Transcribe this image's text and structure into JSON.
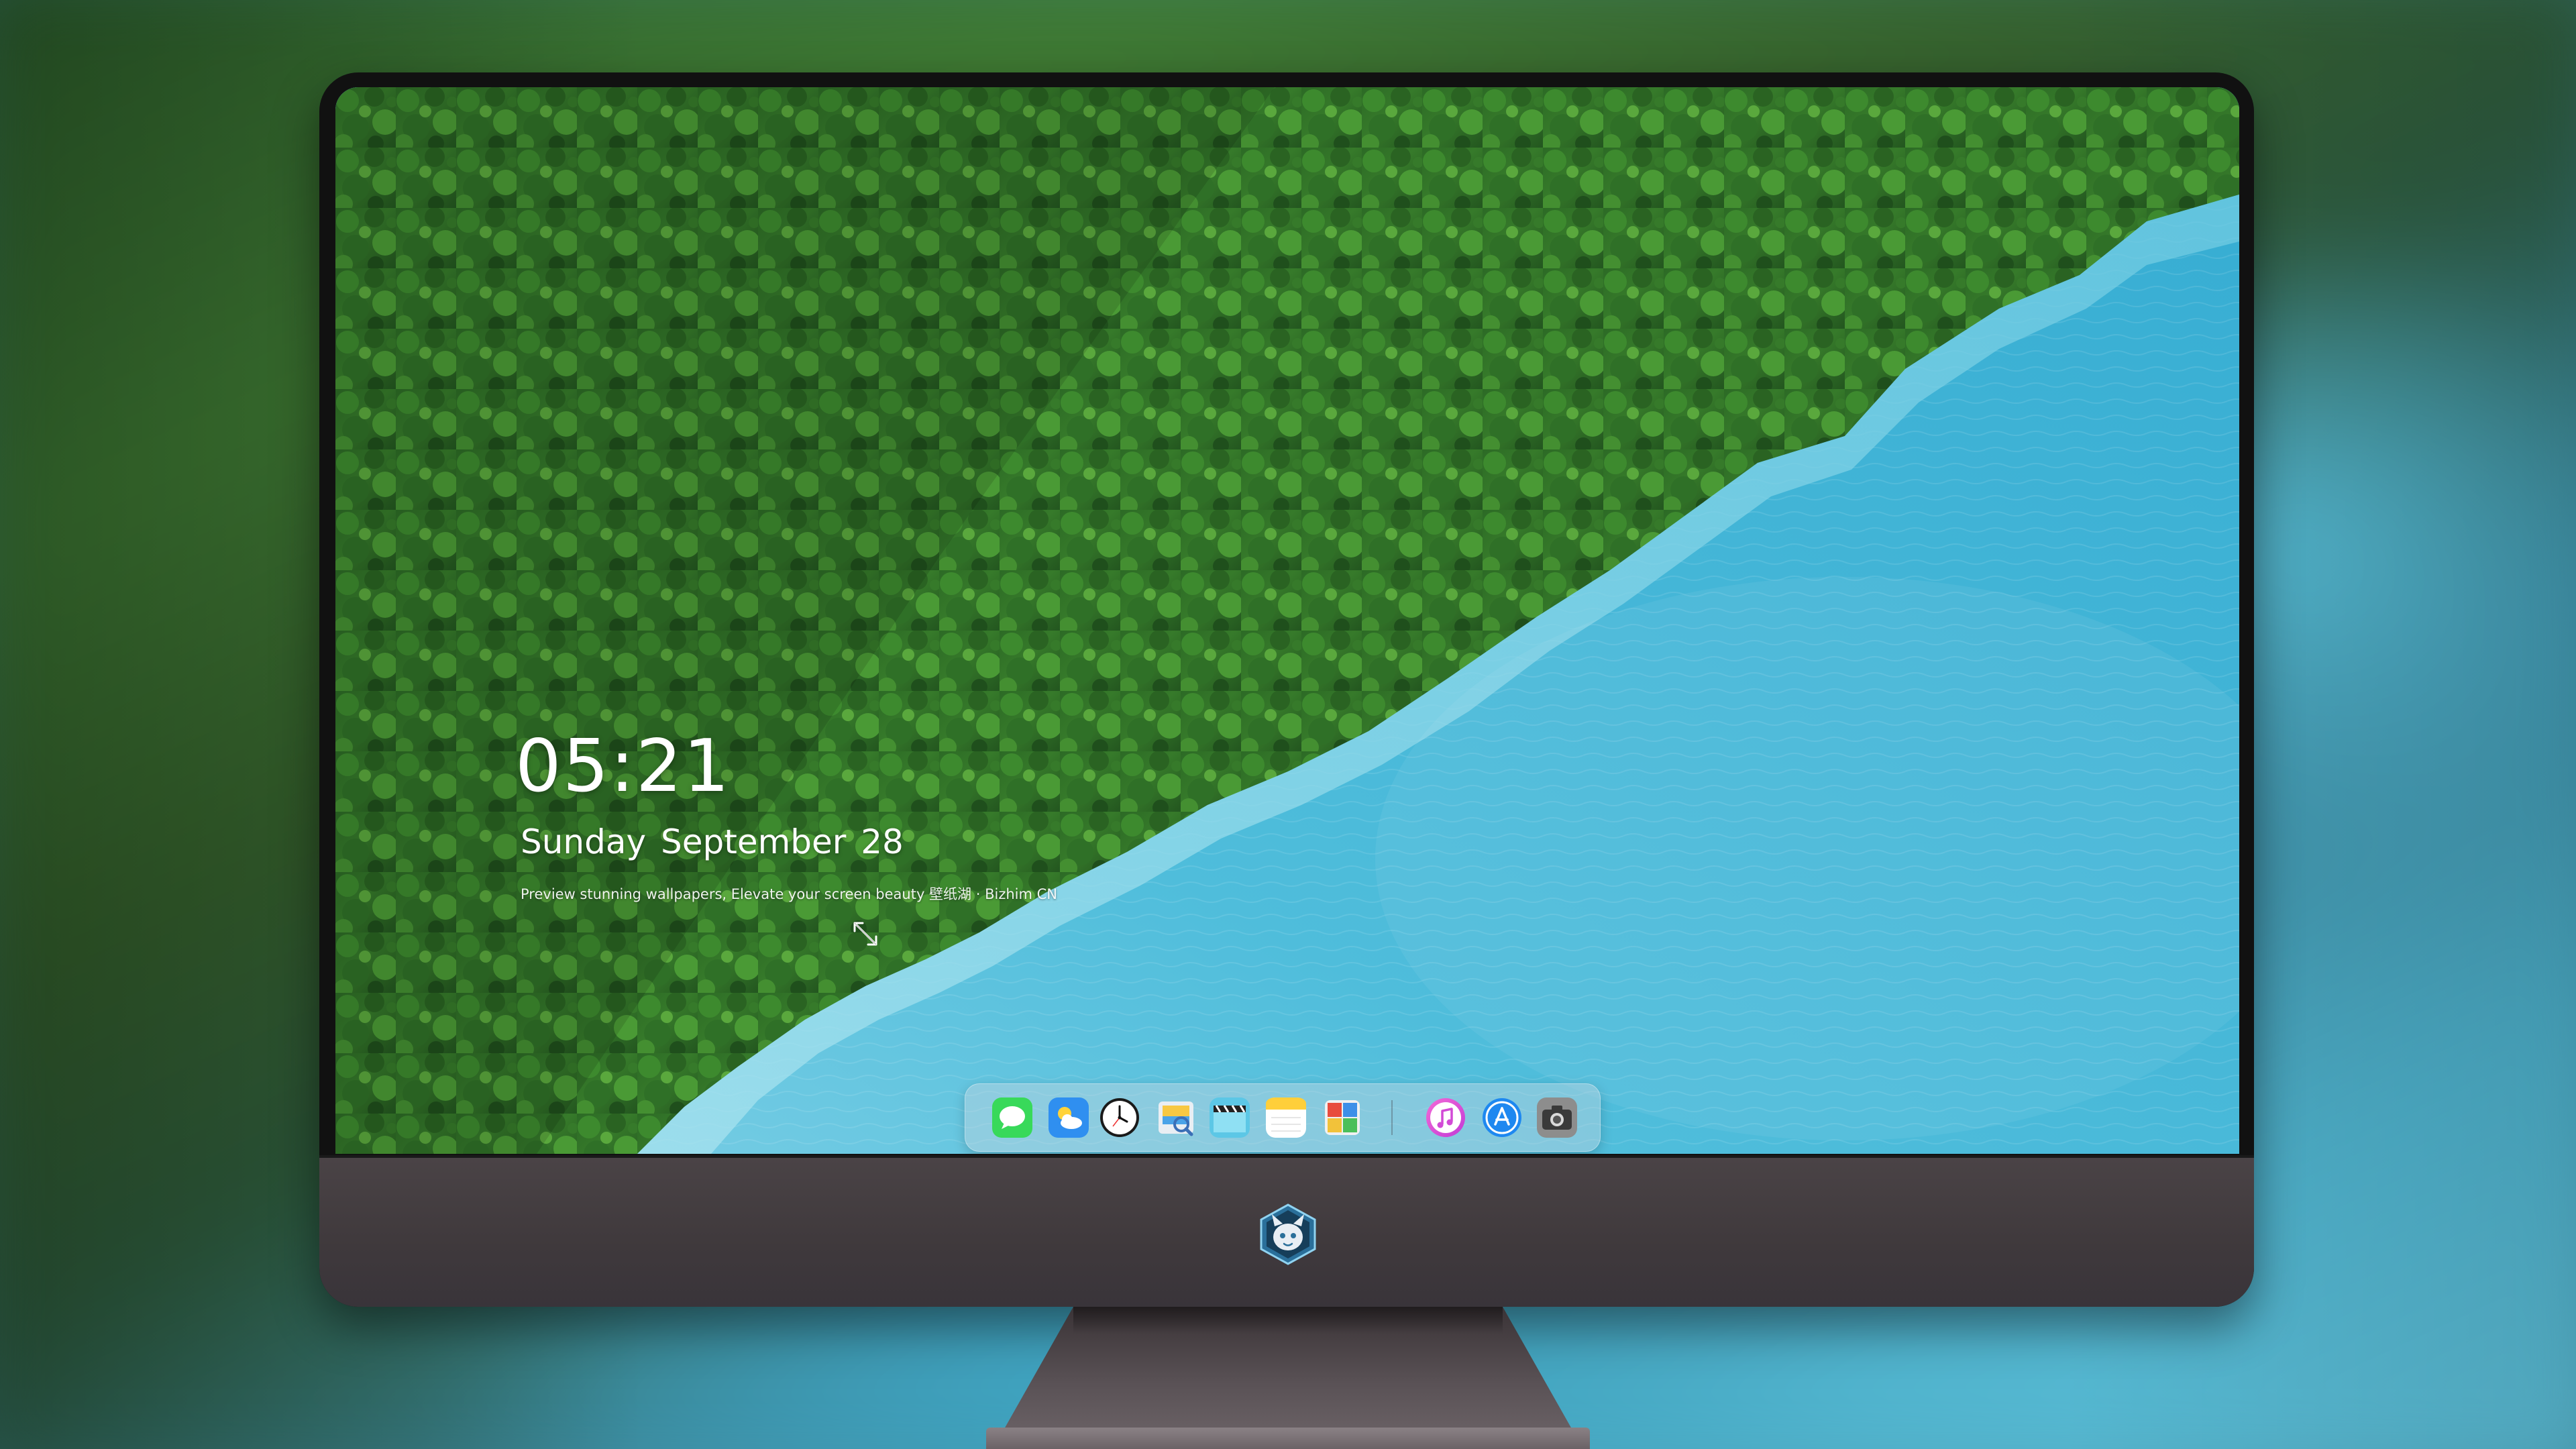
{
  "lock_screen": {
    "time": "05:21",
    "date": "Sunday September  28",
    "tagline": "Preview stunning wallpapers, Elevate your screen beauty 壁纸湖 · Bizhim CN"
  },
  "dock": {
    "apps": [
      {
        "name": "Messages",
        "icon": "messages-icon"
      },
      {
        "name": "Weather",
        "icon": "weather-icon"
      },
      {
        "name": "Clock",
        "icon": "clock-icon"
      },
      {
        "name": "Preview",
        "icon": "preview-icon"
      },
      {
        "name": "Video Editor",
        "icon": "clapperboard-icon"
      },
      {
        "name": "Notes",
        "icon": "notes-icon"
      },
      {
        "name": "Photo Booth",
        "icon": "photo-booth-icon"
      },
      {
        "name": "Music",
        "icon": "music-icon"
      },
      {
        "name": "App Store",
        "icon": "app-store-icon"
      },
      {
        "name": "Camera",
        "icon": "camera-icon"
      }
    ]
  },
  "colors": {
    "forest": "#2f6b2a",
    "water": "#43b6d6",
    "chin": "#423b3f",
    "bezel": "#111111"
  }
}
